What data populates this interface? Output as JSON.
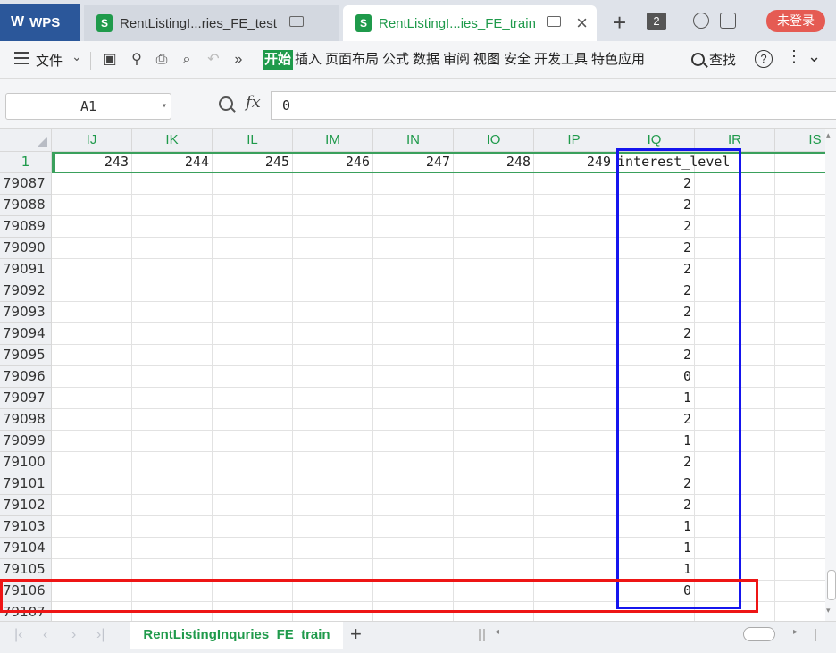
{
  "titlebar": {
    "app_name": "WPS",
    "tabs": [
      {
        "label": "RentListingI...ries_FE_test",
        "active": false
      },
      {
        "label": "RentListingI...ies_FE_train",
        "active": true
      }
    ],
    "tab_count": "2",
    "login_label": "未登录"
  },
  "menubar": {
    "file_label": "文件",
    "items": [
      "开始",
      "插入",
      "页面布局",
      "公式",
      "数据",
      "审阅",
      "视图",
      "安全",
      "开发工具",
      "特色应用"
    ],
    "active_item": "开始",
    "search_label": "查找"
  },
  "formula_bar": {
    "cell_ref": "A1",
    "fx_label": "fx",
    "value": "0"
  },
  "grid": {
    "columns": [
      "IJ",
      "IK",
      "IL",
      "IM",
      "IN",
      "IO",
      "IP",
      "IQ",
      "IR",
      "IS"
    ],
    "header_row": {
      "row_label": "1",
      "values": [
        "243",
        "244",
        "245",
        "246",
        "247",
        "248",
        "249",
        "interest_level",
        "",
        ""
      ]
    },
    "rows": [
      {
        "label": "79087",
        "iq": "2"
      },
      {
        "label": "79088",
        "iq": "2"
      },
      {
        "label": "79089",
        "iq": "2"
      },
      {
        "label": "79090",
        "iq": "2"
      },
      {
        "label": "79091",
        "iq": "2"
      },
      {
        "label": "79092",
        "iq": "2"
      },
      {
        "label": "79093",
        "iq": "2"
      },
      {
        "label": "79094",
        "iq": "2"
      },
      {
        "label": "79095",
        "iq": "2"
      },
      {
        "label": "79096",
        "iq": "0"
      },
      {
        "label": "79097",
        "iq": "1"
      },
      {
        "label": "79098",
        "iq": "2"
      },
      {
        "label": "79099",
        "iq": "1"
      },
      {
        "label": "79100",
        "iq": "2"
      },
      {
        "label": "79101",
        "iq": "2"
      },
      {
        "label": "79102",
        "iq": "2"
      },
      {
        "label": "79103",
        "iq": "1"
      },
      {
        "label": "79104",
        "iq": "1"
      },
      {
        "label": "79105",
        "iq": "1"
      },
      {
        "label": "79106",
        "iq": "0"
      },
      {
        "label": "79107",
        "iq": ""
      }
    ],
    "highlight_colors": {
      "column_box": "#1515ee",
      "row_box": "#ee1515"
    }
  },
  "sheetbar": {
    "sheet_name": "RentListingInquries_FE_train"
  },
  "colors": {
    "accent_green": "#1f9a4b",
    "wps_blue": "#2b579a",
    "login_red": "#e55b53"
  }
}
